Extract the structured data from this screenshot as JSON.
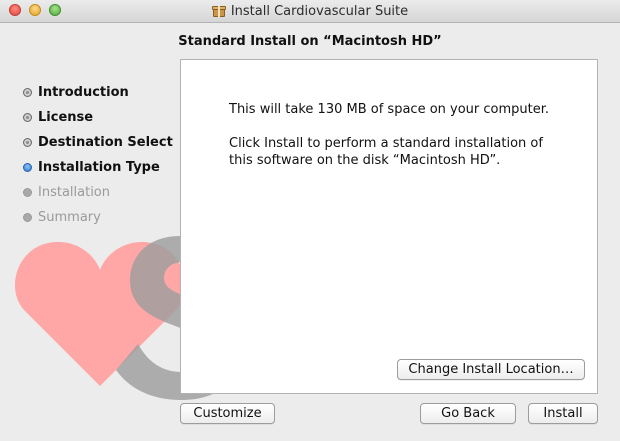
{
  "window": {
    "title": "Install Cardiovascular Suite"
  },
  "heading": "Standard Install on “Macintosh HD”",
  "steps": [
    {
      "label": "Introduction",
      "state": "done"
    },
    {
      "label": "License",
      "state": "done"
    },
    {
      "label": "Destination Select",
      "state": "done"
    },
    {
      "label": "Installation Type",
      "state": "current"
    },
    {
      "label": "Installation",
      "state": "pending"
    },
    {
      "label": "Summary",
      "state": "pending"
    }
  ],
  "content": {
    "space_message": "This will take 130 MB of space on your computer.",
    "install_line1": "Click Install to perform a standard installation of",
    "install_line2": "this software on the disk “Macintosh HD”."
  },
  "buttons": {
    "change_location": "Change Install Location…",
    "customize": "Customize",
    "go_back": "Go Back",
    "install": "Install"
  },
  "colors": {
    "heart": "#ffa6a6",
    "logo_s": "#9d9d9d",
    "current_step": "#2f78d4"
  },
  "icons": {
    "title": "package-icon",
    "logo": "heart-s-logo"
  }
}
